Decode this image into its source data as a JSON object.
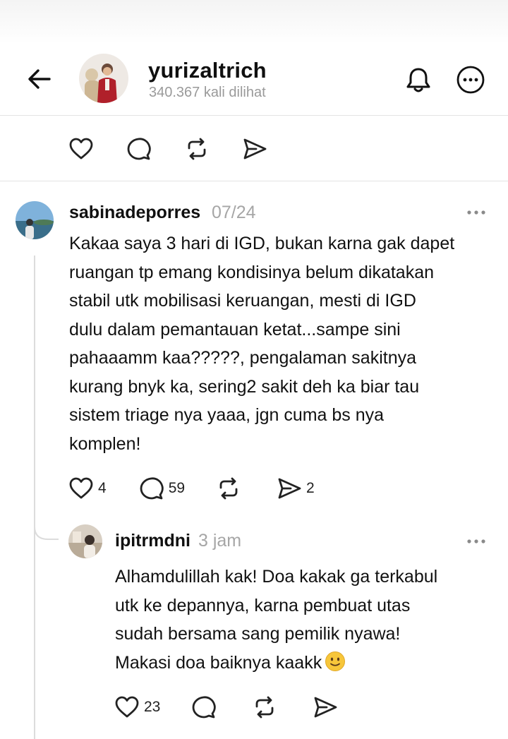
{
  "header": {
    "username": "yurizaltrich",
    "views": "340.367 kali dilihat"
  },
  "post_actions": {
    "like_count": "",
    "reply_count": "",
    "repost_count": "",
    "share_count": ""
  },
  "comments": [
    {
      "username": "sabinadeporres",
      "time": "07/24",
      "text_lines": [
        "Kakaa saya 3 hari di IGD, bukan karna gak dapet",
        "ruangan tp emang kondisinya belum dikatakan",
        "stabil utk mobilisasi keruangan, mesti di IGD",
        "dulu dalam pemantauan ketat...sampe sini",
        "pahaaamm kaa?????, pengalaman sakitnya",
        "kurang bnyk ka, sering2 sakit deh ka biar tau",
        "sistem triage nya yaaa, jgn cuma bs nya",
        "komplen!"
      ],
      "like_count": "4",
      "reply_count": "59",
      "repost_count": "",
      "share_count": "2"
    },
    {
      "username": "ipitrmdni",
      "time": "3 jam",
      "text_lines": [
        "Alhamdulillah kak! Doa kakak ga terkabul",
        "utk ke depannya, karna pembuat utas",
        "sudah bersama sang pemilik nyawa!",
        "Makasi doa baiknya kaakk"
      ],
      "emoji": "slightly-smiling-face",
      "like_count": "23",
      "reply_count": "",
      "repost_count": "",
      "share_count": ""
    }
  ],
  "colors": {
    "text": "#101010",
    "muted": "#9a9a9a",
    "divider": "#e3e3e3"
  }
}
